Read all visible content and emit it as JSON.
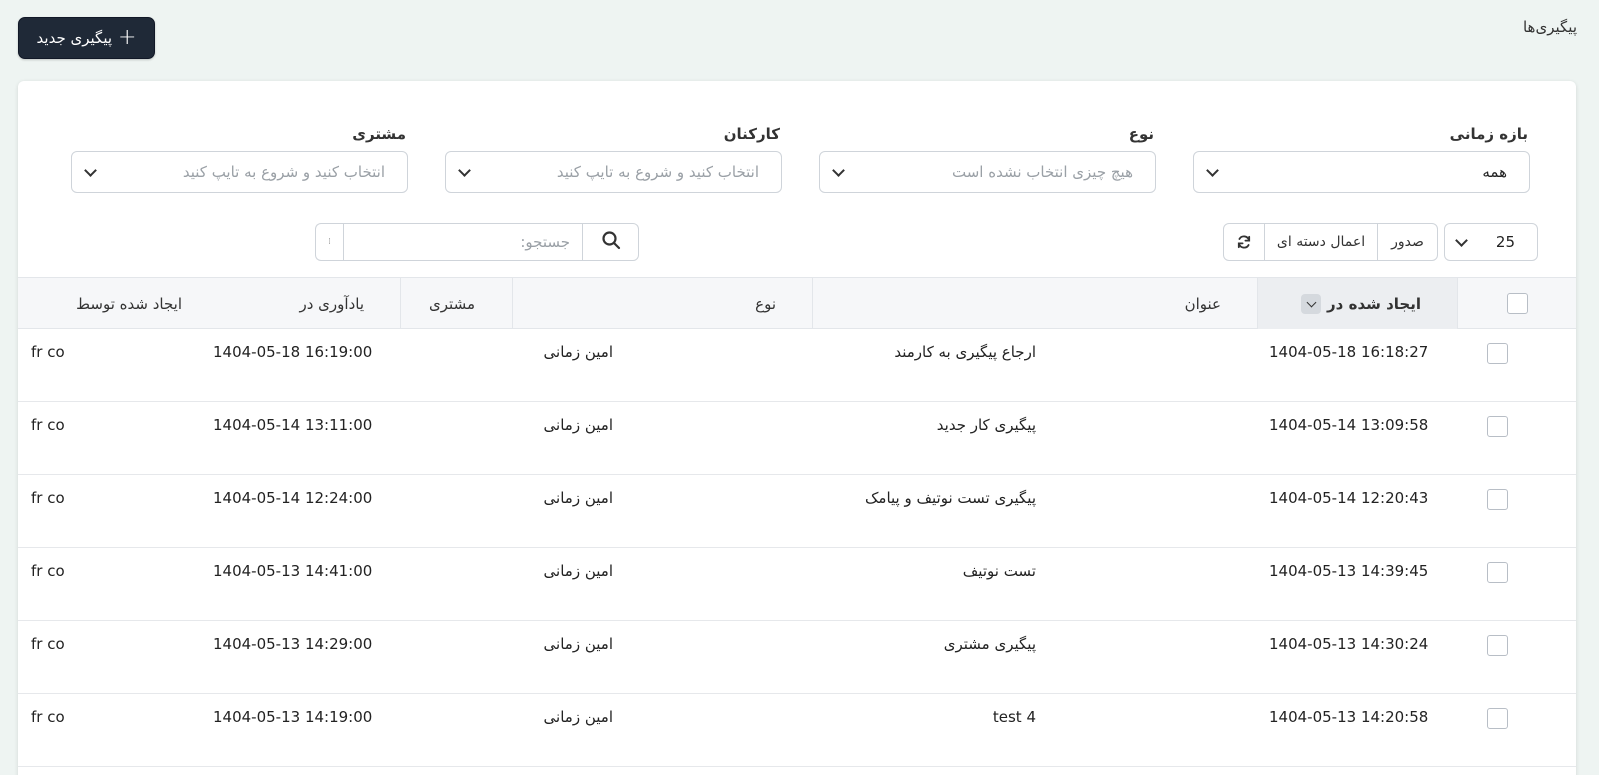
{
  "header": {
    "title": "پیگیری‌ها",
    "new_button_label": "پیگیری جدید",
    "new_button_icon": "plus-icon"
  },
  "filters": {
    "time_range": {
      "label": "بازه زمانی",
      "value": "همه"
    },
    "type": {
      "label": "نوع",
      "placeholder": "هیچ چیزی انتخاب نشده است"
    },
    "staff": {
      "label": "کارکنان",
      "placeholder": "انتخاب کنید و شروع به تایپ کنید"
    },
    "customer": {
      "label": "مشتری",
      "placeholder": "انتخاب کنید و شروع به تایپ کنید"
    }
  },
  "toolbar": {
    "per_page": "25",
    "export_label": "صدور",
    "bulk_label": "اعمال دسته ای",
    "refresh_icon": "refresh-icon",
    "search_placeholder": "جستجو:",
    "search_icon": "search-icon"
  },
  "table": {
    "columns": {
      "created_at": "ایجاد شده در",
      "title": "عنوان",
      "type": "نوع",
      "customer": "مشتری",
      "reminder_at": "یادآوری در",
      "created_by": "ایجاد شده توسط"
    },
    "rows": [
      {
        "created_at": "1404-05-18 16:18:27",
        "title": "ارجاع پیگیری به کارمند",
        "type": "امین زمانی",
        "customer": "",
        "reminder_at": "1404-05-18 16:19:00",
        "created_by": "fr co"
      },
      {
        "created_at": "1404-05-14 13:09:58",
        "title": "پیگیری کار جدید",
        "type": "امین زمانی",
        "customer": "",
        "reminder_at": "1404-05-14 13:11:00",
        "created_by": "fr co"
      },
      {
        "created_at": "1404-05-14 12:20:43",
        "title": "پیگیری تست نوتیف و پیامک",
        "type": "امین زمانی",
        "customer": "",
        "reminder_at": "1404-05-14 12:24:00",
        "created_by": "fr co"
      },
      {
        "created_at": "1404-05-13 14:39:45",
        "title": "تست نوتیف",
        "type": "امین زمانی",
        "customer": "",
        "reminder_at": "1404-05-13 14:41:00",
        "created_by": "fr co"
      },
      {
        "created_at": "1404-05-13 14:30:24",
        "title": "پیگیری مشتری",
        "type": "امین زمانی",
        "customer": "",
        "reminder_at": "1404-05-13 14:29:00",
        "created_by": "fr co"
      },
      {
        "created_at": "1404-05-13 14:20:58",
        "title": "test 4",
        "type": "امین زمانی",
        "customer": "",
        "reminder_at": "1404-05-13 14:19:00",
        "created_by": "fr co"
      }
    ]
  }
}
